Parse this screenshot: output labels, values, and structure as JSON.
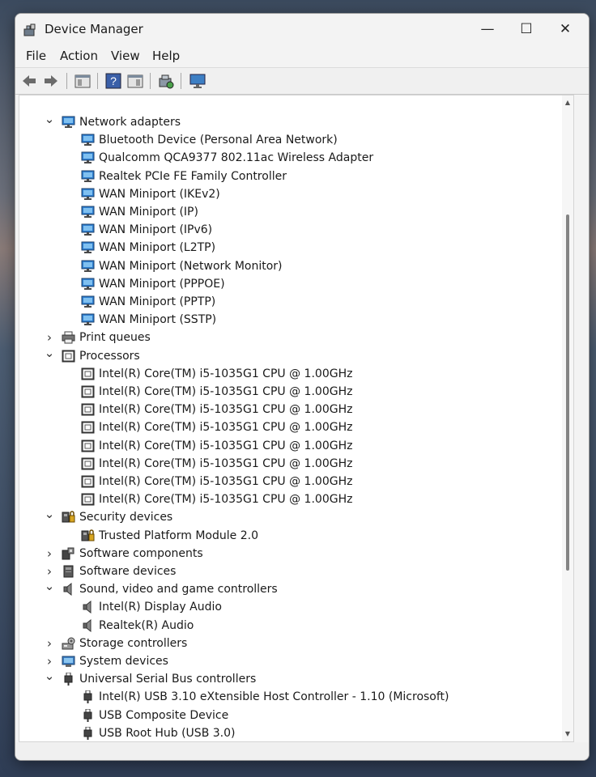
{
  "window": {
    "title": "Device Manager"
  },
  "window_controls": {
    "minimize": "—",
    "maximize": "☐",
    "close": "✕"
  },
  "menu": [
    "File",
    "Action",
    "View",
    "Help"
  ],
  "toolbar": {
    "buttons": [
      "back-arrow-icon",
      "forward-arrow-icon",
      "properties-icon",
      "help-icon",
      "show-hidden-icon",
      "update-driver-icon",
      "monitor-icon"
    ]
  },
  "tree": [
    {
      "label": "Network adapters",
      "level": 0,
      "expander": "expanded",
      "icon": "network"
    },
    {
      "label": "Bluetooth Device (Personal Area Network)",
      "level": 1,
      "icon": "network"
    },
    {
      "label": "Qualcomm QCA9377 802.11ac Wireless Adapter",
      "level": 1,
      "icon": "network"
    },
    {
      "label": "Realtek PCIe FE Family Controller",
      "level": 1,
      "icon": "network"
    },
    {
      "label": "WAN Miniport (IKEv2)",
      "level": 1,
      "icon": "network"
    },
    {
      "label": "WAN Miniport (IP)",
      "level": 1,
      "icon": "network"
    },
    {
      "label": "WAN Miniport (IPv6)",
      "level": 1,
      "icon": "network"
    },
    {
      "label": "WAN Miniport (L2TP)",
      "level": 1,
      "icon": "network"
    },
    {
      "label": "WAN Miniport (Network Monitor)",
      "level": 1,
      "icon": "network"
    },
    {
      "label": "WAN Miniport (PPPOE)",
      "level": 1,
      "icon": "network"
    },
    {
      "label": "WAN Miniport (PPTP)",
      "level": 1,
      "icon": "network"
    },
    {
      "label": "WAN Miniport (SSTP)",
      "level": 1,
      "icon": "network"
    },
    {
      "label": "Print queues",
      "level": 0,
      "expander": "collapsed",
      "icon": "printer"
    },
    {
      "label": "Processors",
      "level": 0,
      "expander": "expanded",
      "icon": "processor"
    },
    {
      "label": "Intel(R) Core(TM) i5-1035G1 CPU @ 1.00GHz",
      "level": 1,
      "icon": "processor"
    },
    {
      "label": "Intel(R) Core(TM) i5-1035G1 CPU @ 1.00GHz",
      "level": 1,
      "icon": "processor"
    },
    {
      "label": "Intel(R) Core(TM) i5-1035G1 CPU @ 1.00GHz",
      "level": 1,
      "icon": "processor"
    },
    {
      "label": "Intel(R) Core(TM) i5-1035G1 CPU @ 1.00GHz",
      "level": 1,
      "icon": "processor"
    },
    {
      "label": "Intel(R) Core(TM) i5-1035G1 CPU @ 1.00GHz",
      "level": 1,
      "icon": "processor"
    },
    {
      "label": "Intel(R) Core(TM) i5-1035G1 CPU @ 1.00GHz",
      "level": 1,
      "icon": "processor"
    },
    {
      "label": "Intel(R) Core(TM) i5-1035G1 CPU @ 1.00GHz",
      "level": 1,
      "icon": "processor"
    },
    {
      "label": "Intel(R) Core(TM) i5-1035G1 CPU @ 1.00GHz",
      "level": 1,
      "icon": "processor"
    },
    {
      "label": "Security devices",
      "level": 0,
      "expander": "expanded",
      "icon": "security"
    },
    {
      "label": "Trusted Platform Module 2.0",
      "level": 1,
      "icon": "security"
    },
    {
      "label": "Software components",
      "level": 0,
      "expander": "collapsed",
      "icon": "software-component"
    },
    {
      "label": "Software devices",
      "level": 0,
      "expander": "collapsed",
      "icon": "software-device"
    },
    {
      "label": "Sound, video and game controllers",
      "level": 0,
      "expander": "expanded",
      "icon": "speaker"
    },
    {
      "label": "Intel(R) Display Audio",
      "level": 1,
      "icon": "speaker"
    },
    {
      "label": "Realtek(R) Audio",
      "level": 1,
      "icon": "speaker"
    },
    {
      "label": "Storage controllers",
      "level": 0,
      "expander": "collapsed",
      "icon": "storage"
    },
    {
      "label": "System devices",
      "level": 0,
      "expander": "collapsed",
      "icon": "system"
    },
    {
      "label": "Universal Serial Bus controllers",
      "level": 0,
      "expander": "expanded",
      "icon": "usb"
    },
    {
      "label": "Intel(R) USB 3.10 eXtensible Host Controller - 1.10 (Microsoft)",
      "level": 1,
      "icon": "usb"
    },
    {
      "label": "USB Composite Device",
      "level": 1,
      "icon": "usb"
    },
    {
      "label": "USB Root Hub (USB 3.0)",
      "level": 1,
      "icon": "usb"
    }
  ],
  "scrollbar": {
    "position": 0.4
  }
}
